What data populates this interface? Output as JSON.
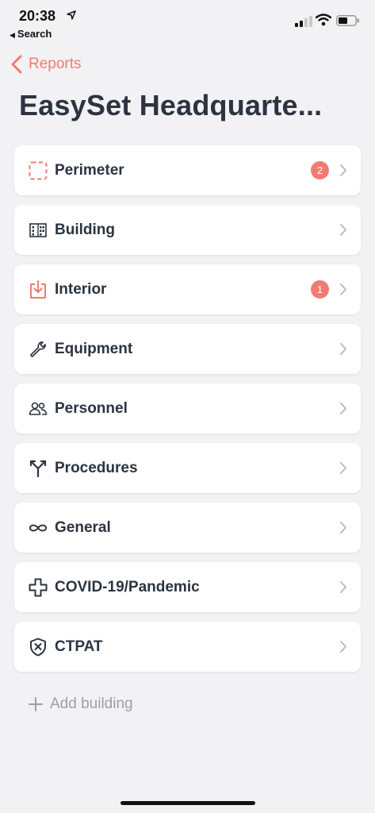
{
  "status": {
    "time": "20:38",
    "back_app": "Search"
  },
  "nav": {
    "back_label": "Reports"
  },
  "page": {
    "title": "EasySet Headquarte..."
  },
  "items": [
    {
      "label": "Perimeter",
      "icon": "perimeter-icon",
      "badge": "2"
    },
    {
      "label": "Building",
      "icon": "building-icon",
      "badge": null
    },
    {
      "label": "Interior",
      "icon": "interior-icon",
      "badge": "1"
    },
    {
      "label": "Equipment",
      "icon": "wrench-icon",
      "badge": null
    },
    {
      "label": "Personnel",
      "icon": "people-icon",
      "badge": null
    },
    {
      "label": "Procedures",
      "icon": "fork-icon",
      "badge": null
    },
    {
      "label": "General",
      "icon": "infinity-icon",
      "badge": null
    },
    {
      "label": "COVID-19/Pandemic",
      "icon": "medical-cross-icon",
      "badge": null
    },
    {
      "label": "CTPAT",
      "icon": "shield-x-icon",
      "badge": null
    }
  ],
  "add_building": {
    "label": "Add building"
  },
  "colors": {
    "accent": "#f07b73",
    "text": "#2b3440",
    "muted": "#9aa0a8",
    "chevron": "#b8bcc2"
  }
}
